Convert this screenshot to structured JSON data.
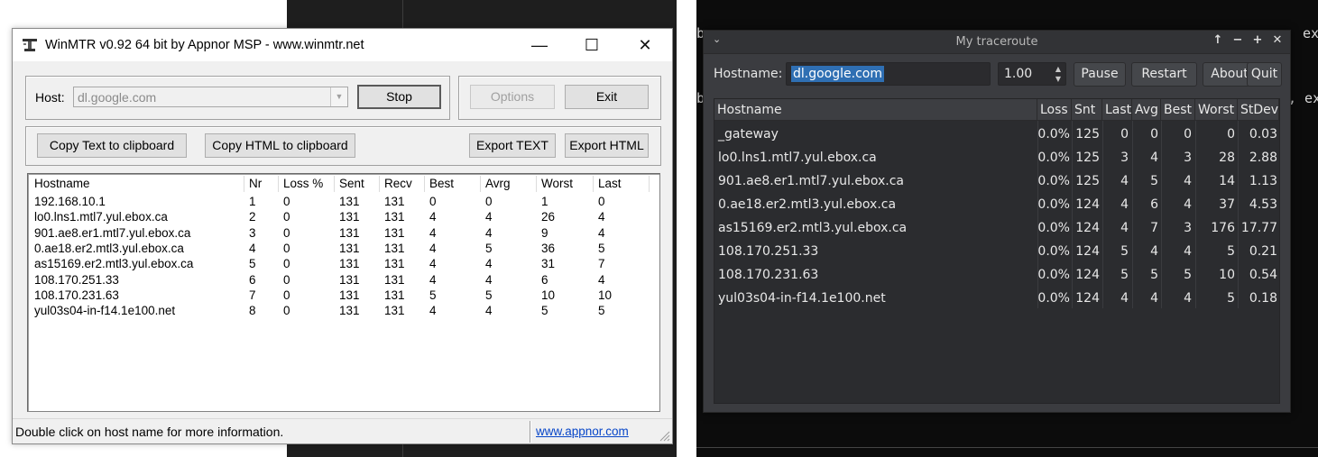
{
  "background": {
    "terminal_left_lines": [
      "b",
      "b"
    ],
    "terminal_right_lines": [
      "ex",
      ", ex"
    ]
  },
  "winmtr": {
    "title": "WinMTR v0.92 64 bit by Appnor MSP - www.winmtr.net",
    "window_controls": {
      "minimize": "—",
      "maximize": "☐",
      "close": "✕"
    },
    "host_label": "Host:",
    "host_value": "dl.google.com",
    "buttons": {
      "stop": "Stop",
      "options": "Options",
      "exit": "Exit",
      "copy_text": "Copy Text to clipboard",
      "copy_html": "Copy HTML to clipboard",
      "export_text": "Export TEXT",
      "export_html": "Export HTML"
    },
    "columns": [
      "Hostname",
      "Nr",
      "Loss %",
      "Sent",
      "Recv",
      "Best",
      "Avrg",
      "Worst",
      "Last"
    ],
    "rows": [
      [
        "192.168.10.1",
        "1",
        "0",
        "131",
        "131",
        "0",
        "0",
        "1",
        "0"
      ],
      [
        "lo0.lns1.mtl7.yul.ebox.ca",
        "2",
        "0",
        "131",
        "131",
        "4",
        "4",
        "26",
        "4"
      ],
      [
        "901.ae8.er1.mtl7.yul.ebox.ca",
        "3",
        "0",
        "131",
        "131",
        "4",
        "4",
        "9",
        "4"
      ],
      [
        "0.ae18.er2.mtl3.yul.ebox.ca",
        "4",
        "0",
        "131",
        "131",
        "4",
        "5",
        "36",
        "5"
      ],
      [
        "as15169.er2.mtl3.yul.ebox.ca",
        "5",
        "0",
        "131",
        "131",
        "4",
        "4",
        "31",
        "7"
      ],
      [
        "108.170.251.33",
        "6",
        "0",
        "131",
        "131",
        "4",
        "4",
        "6",
        "4"
      ],
      [
        "108.170.231.63",
        "7",
        "0",
        "131",
        "131",
        "5",
        "5",
        "10",
        "10"
      ],
      [
        "yul03s04-in-f14.1e100.net",
        "8",
        "0",
        "131",
        "131",
        "4",
        "4",
        "5",
        "5"
      ]
    ],
    "status_text": "Double click on host name for more information.",
    "status_link": "www.appnor.com"
  },
  "mtr": {
    "title": "My traceroute",
    "window_controls": {
      "menu": "⌄",
      "up": "↑",
      "minimize": "−",
      "maximize": "+",
      "close": "✕"
    },
    "host_label": "Hostname:",
    "host_value": "dl.google.com",
    "interval": "1.00",
    "buttons": {
      "pause": "Pause",
      "restart": "Restart",
      "about": "About",
      "quit": "Quit"
    },
    "columns": [
      "Hostname",
      "Loss",
      "Snt",
      "Last",
      "Avg",
      "Best",
      "Worst",
      "StDev"
    ],
    "rows": [
      [
        "_gateway",
        "0.0%",
        "125",
        "0",
        "0",
        "0",
        "0",
        "0.03"
      ],
      [
        "lo0.lns1.mtl7.yul.ebox.ca",
        "0.0%",
        "125",
        "3",
        "4",
        "3",
        "28",
        "2.88"
      ],
      [
        "901.ae8.er1.mtl7.yul.ebox.ca",
        "0.0%",
        "125",
        "4",
        "5",
        "4",
        "14",
        "1.13"
      ],
      [
        "0.ae18.er2.mtl3.yul.ebox.ca",
        "0.0%",
        "124",
        "4",
        "6",
        "4",
        "37",
        "4.53"
      ],
      [
        "as15169.er2.mtl3.yul.ebox.ca",
        "0.0%",
        "124",
        "4",
        "7",
        "3",
        "176",
        "17.77"
      ],
      [
        "108.170.251.33",
        "0.0%",
        "124",
        "5",
        "4",
        "4",
        "5",
        "0.21"
      ],
      [
        "108.170.231.63",
        "0.0%",
        "124",
        "5",
        "5",
        "5",
        "10",
        "0.54"
      ],
      [
        "yul03s04-in-f14.1e100.net",
        "0.0%",
        "124",
        "4",
        "4",
        "4",
        "5",
        "0.18"
      ]
    ]
  }
}
